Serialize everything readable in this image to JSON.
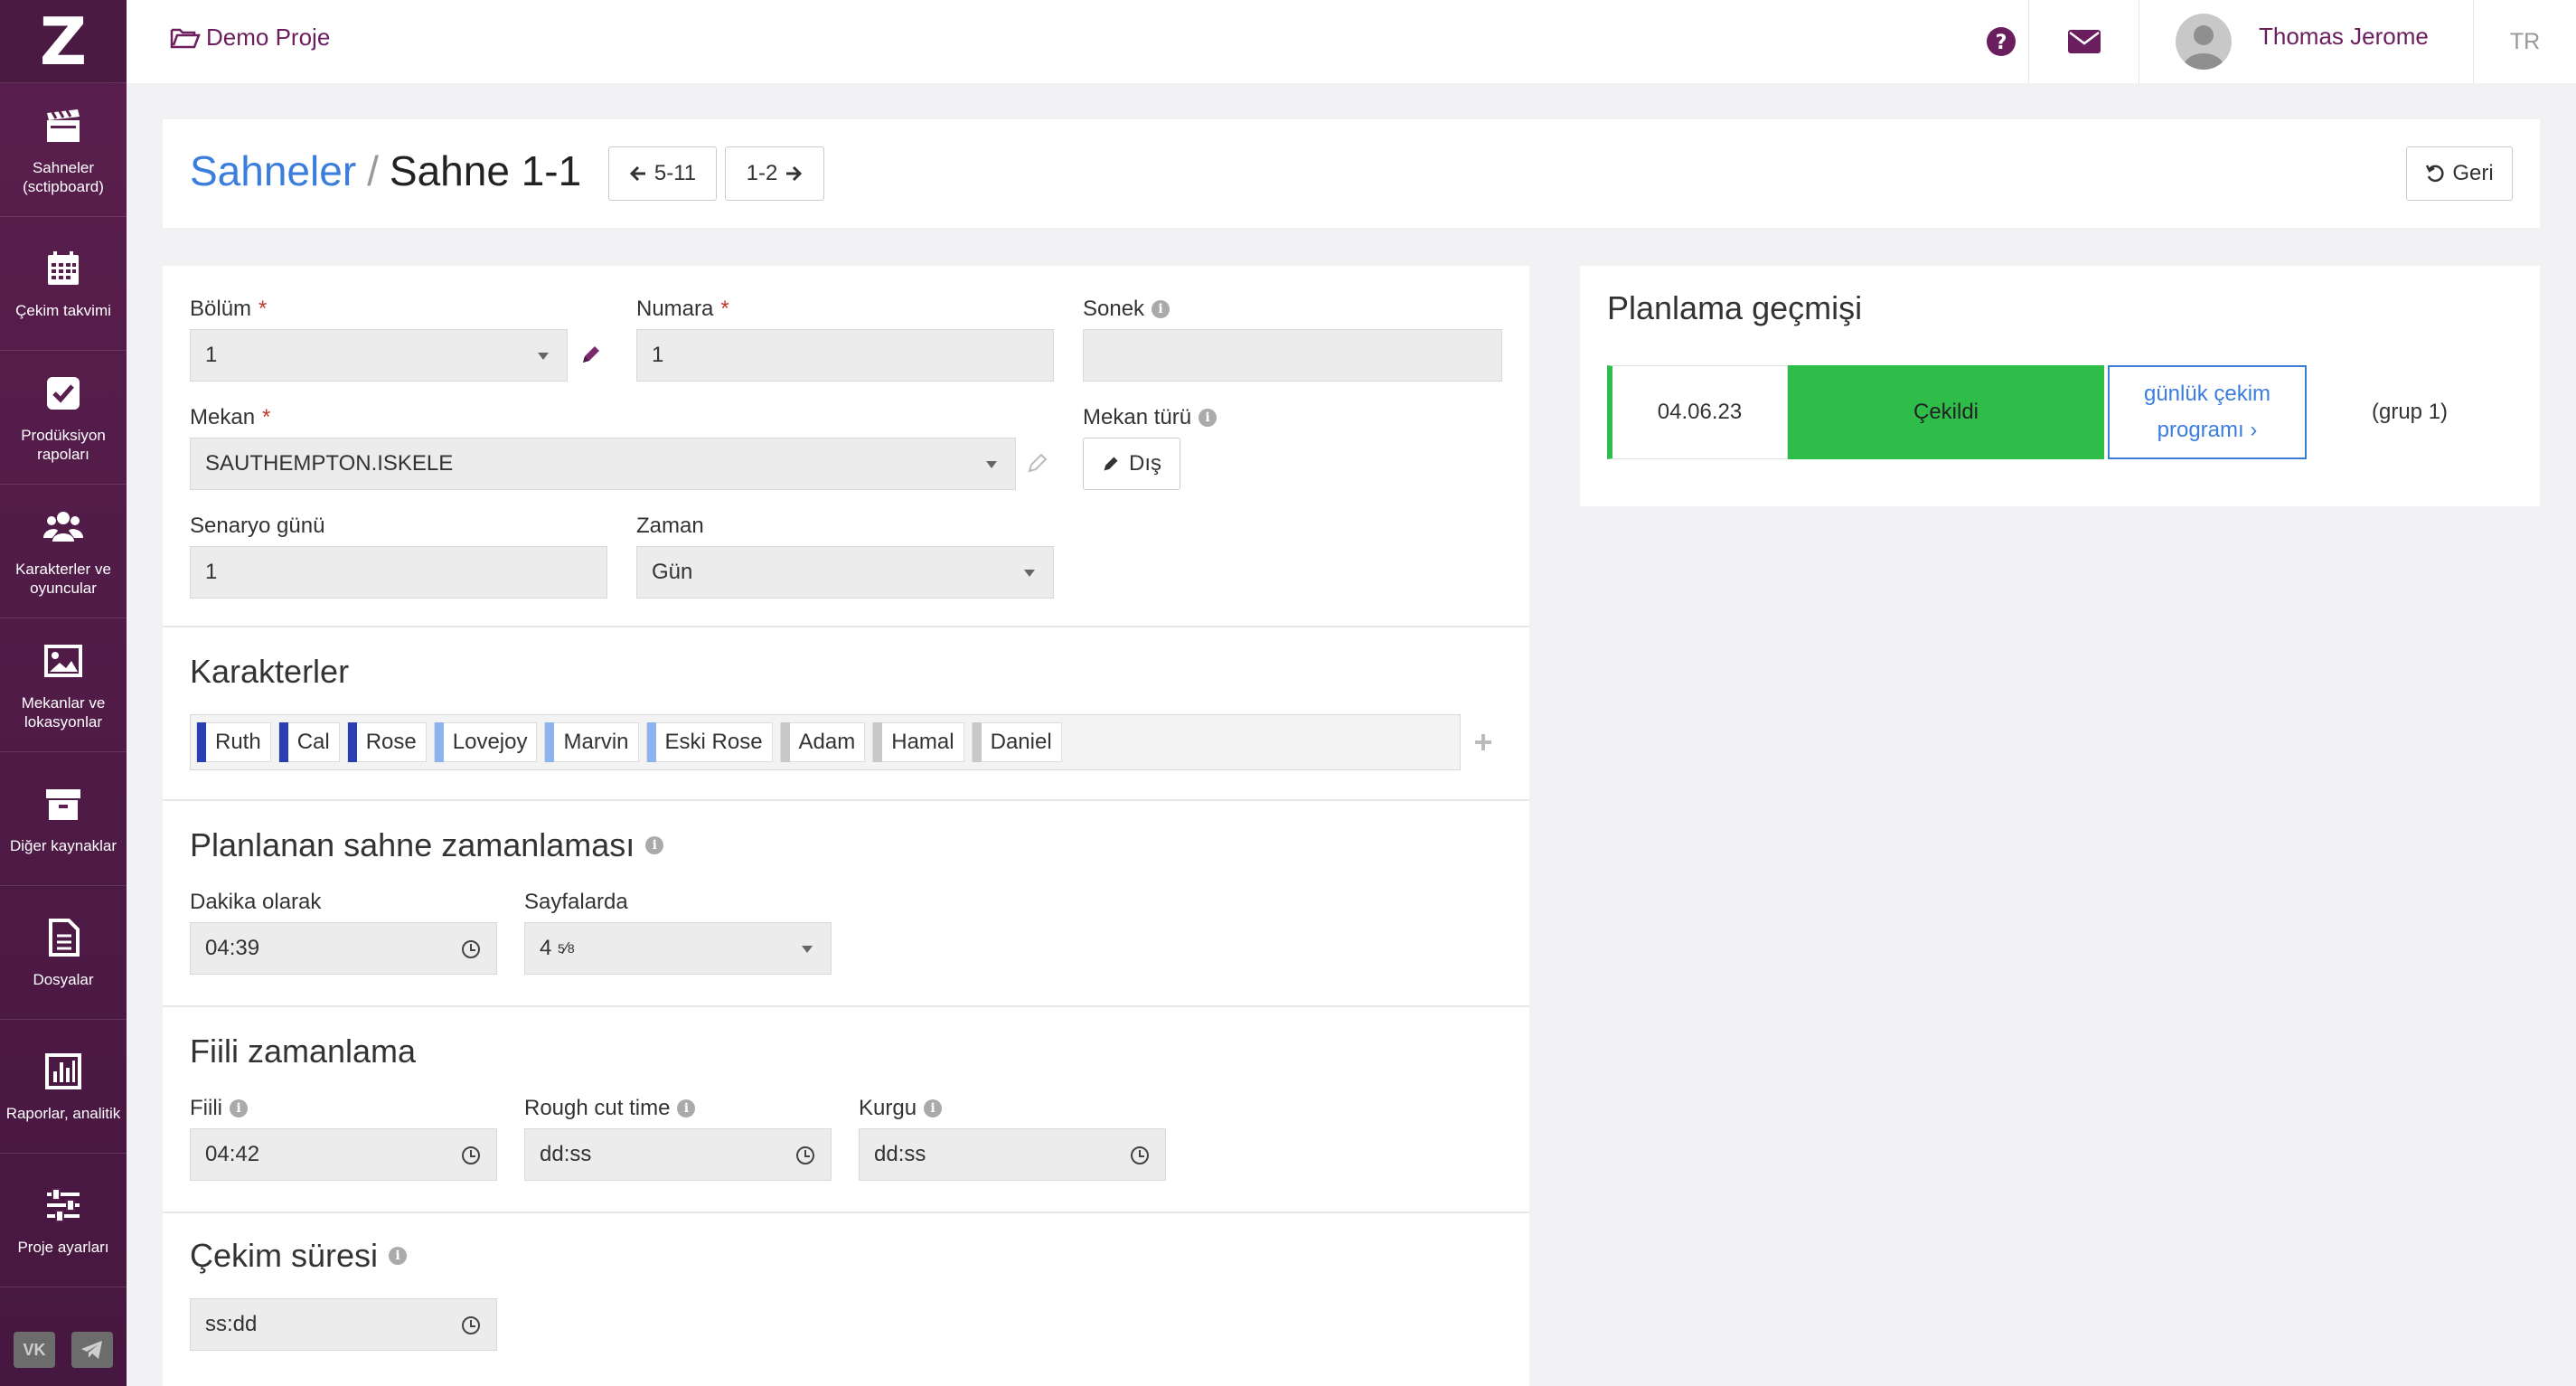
{
  "sidebar": {
    "logo": "Z",
    "items": [
      {
        "label": "Sahneler (sctipboard)",
        "icon": "clapperboard-icon"
      },
      {
        "label": "Çekim takvimi",
        "icon": "calendar-icon"
      },
      {
        "label": "Prodüksiyon rapoları",
        "icon": "checkbox-icon"
      },
      {
        "label": "Karakterler ve oyuncular",
        "icon": "users-icon"
      },
      {
        "label": "Mekanlar ve lokasyonlar",
        "icon": "image-icon"
      },
      {
        "label": "Diğer kaynaklar",
        "icon": "archive-icon"
      },
      {
        "label": "Dosyalar",
        "icon": "file-icon"
      },
      {
        "label": "Raporlar, analitik",
        "icon": "bar-chart-icon"
      },
      {
        "label": "Proje ayarları",
        "icon": "sliders-icon"
      }
    ],
    "social": [
      "VK",
      "TG"
    ]
  },
  "topbar": {
    "project": "Demo Proje",
    "user_name": "Thomas Jerome",
    "lang": "TR"
  },
  "header": {
    "breadcrumb_link": "Sahneler",
    "separator": "/",
    "current": "Sahne 1-1",
    "prev_label": "5-11",
    "next_label": "1-2",
    "back_label": "Geri"
  },
  "form": {
    "bolum_label": "Bölüm",
    "bolum_value": "1",
    "numara_label": "Numara",
    "numara_value": "1",
    "sonek_label": "Sonek",
    "sonek_value": "",
    "mekan_label": "Mekan",
    "mekan_value": "SAUTHEMPTON.ISKELE",
    "mekan_turu_label": "Mekan türü",
    "mekan_turu_value": "Dış",
    "senaryo_gunu_label": "Senaryo günü",
    "senaryo_gunu_value": "1",
    "zaman_label": "Zaman",
    "zaman_value": "Gün",
    "required_mark": "*"
  },
  "characters": {
    "title": "Karakterler",
    "items": [
      {
        "name": "Ruth",
        "color": "#2a3fb4"
      },
      {
        "name": "Cal",
        "color": "#2a3fb4"
      },
      {
        "name": "Rose",
        "color": "#2a3fb4"
      },
      {
        "name": "Lovejoy",
        "color": "#8db4ee"
      },
      {
        "name": "Marvin",
        "color": "#8db4ee"
      },
      {
        "name": "Eski Rose",
        "color": "#8db4ee"
      },
      {
        "name": "Adam",
        "color": "#c8c8c8"
      },
      {
        "name": "Hamal",
        "color": "#c8c8c8"
      },
      {
        "name": "Daniel",
        "color": "#c8c8c8"
      }
    ]
  },
  "planned": {
    "title": "Planlanan sahne zamanlaması",
    "dakika_label": "Dakika olarak",
    "dakika_value": "04:39",
    "sayfalarda_label": "Sayfalarda",
    "sayfalarda_whole": "4",
    "sayfalarda_num": "5",
    "sayfalarda_den": "8"
  },
  "actual": {
    "title": "Fiili zamanlama",
    "fiili_label": "Fiili",
    "fiili_value": "04:42",
    "rough_label": "Rough cut time",
    "rough_placeholder": "dd:ss",
    "kurgu_label": "Kurgu",
    "kurgu_placeholder": "dd:ss"
  },
  "shooting": {
    "title": "Çekim süresi",
    "placeholder": "ss:dd"
  },
  "history": {
    "title": "Planlama geçmişi",
    "date": "04.06.23",
    "status": "Çekildi",
    "status_color": "#2fbd4a",
    "link": "günlük çekim programı ›",
    "group": "(grup 1)"
  },
  "colors": {
    "brand": "#5a1f4e",
    "link": "#3b7ddd",
    "required": "#c0392b"
  }
}
